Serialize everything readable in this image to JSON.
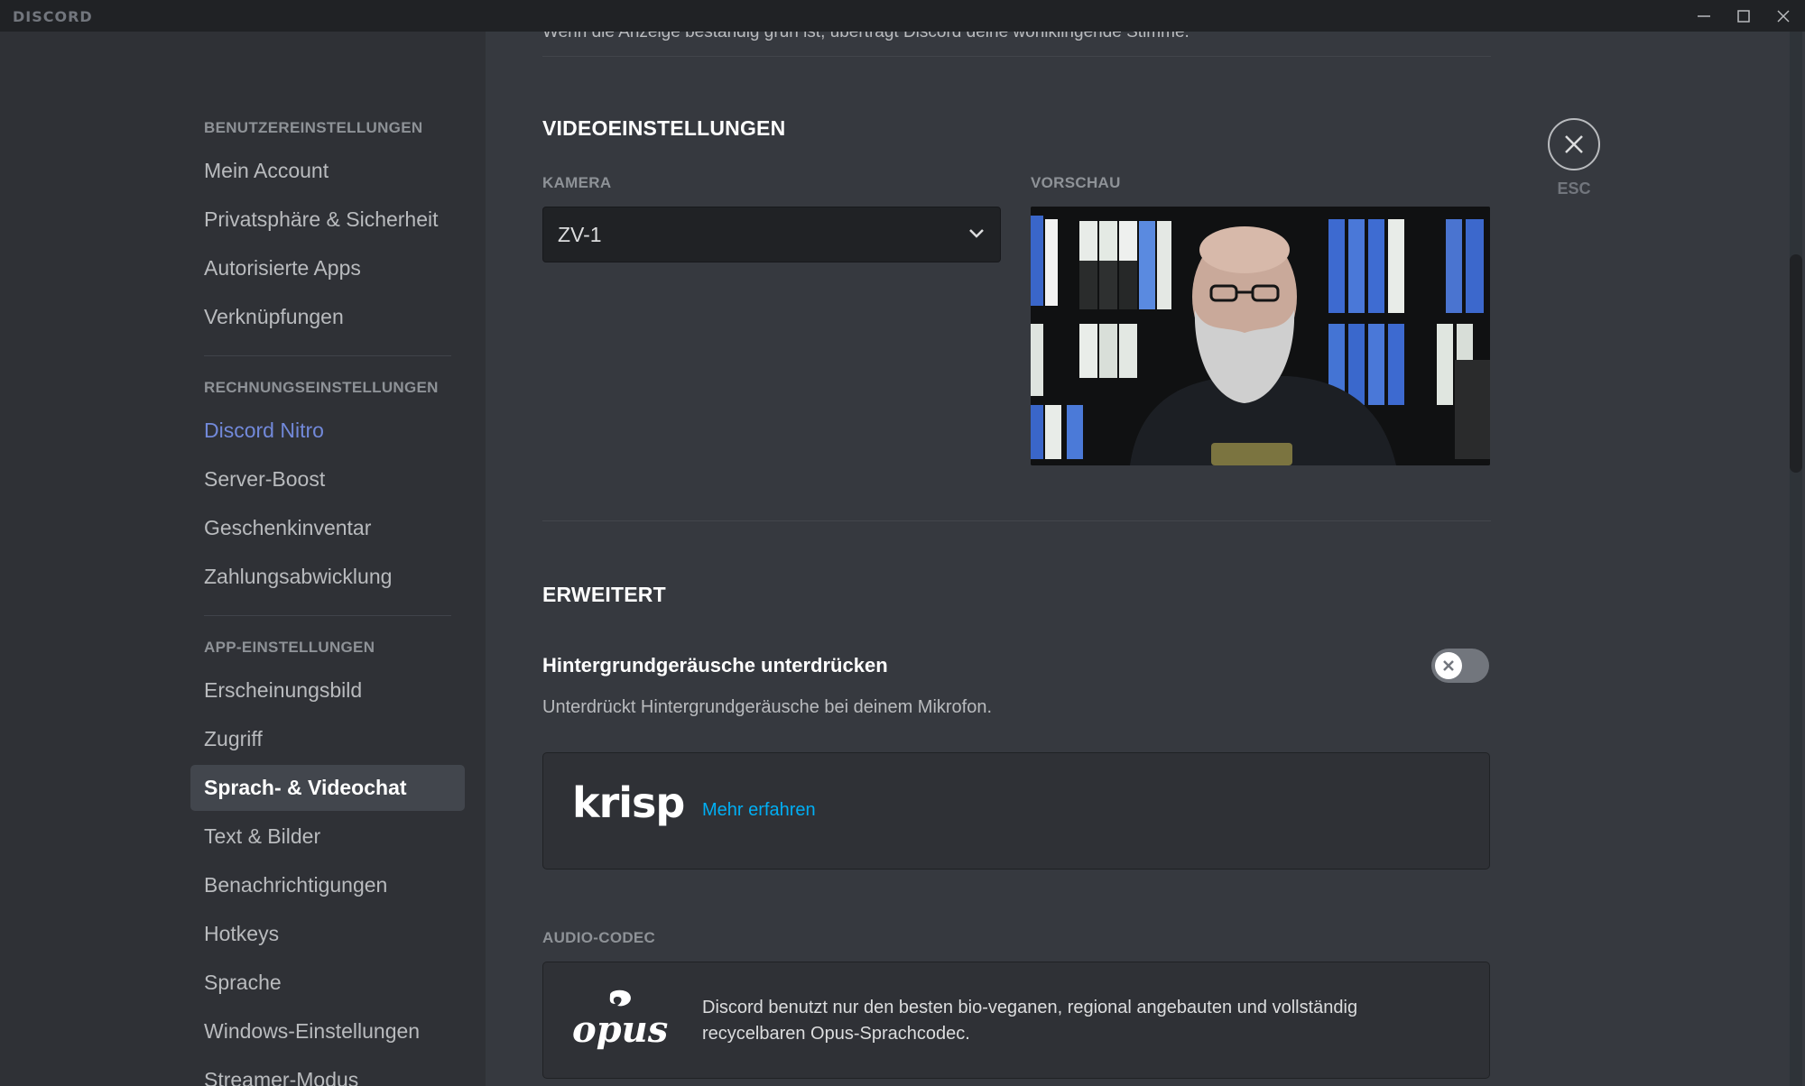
{
  "window": {
    "app_name": "DISCORD",
    "minimize_icon": "minimize-icon",
    "maximize_icon": "maximize-icon",
    "close_icon": "close-icon"
  },
  "sidebar": {
    "user_settings": {
      "header": "BENUTZEREINSTELLUNGEN",
      "items": [
        "Mein Account",
        "Privatsphäre & Sicherheit",
        "Autorisierte Apps",
        "Verknüpfungen"
      ]
    },
    "billing_settings": {
      "header": "RECHNUNGSEINSTELLUNGEN",
      "items": [
        "Discord Nitro",
        "Server-Boost",
        "Geschenkinventar",
        "Zahlungsabwicklung"
      ]
    },
    "app_settings": {
      "header": "APP-EINSTELLUNGEN",
      "items": [
        "Erscheinungsbild",
        "Zugriff",
        "Sprach- & Videochat",
        "Text & Bilder",
        "Benachrichtigungen",
        "Hotkeys",
        "Sprache",
        "Windows-Einstellungen",
        "Streamer-Modus"
      ]
    },
    "active_item": "Sprach- & Videochat",
    "nitro_color": "#7289da"
  },
  "main": {
    "cut_text": "Wenn die Anzeige beständig grün ist, überträgt Discord deine wohlklingende Stimme.",
    "video": {
      "title": "VIDEOEINSTELLUNGEN",
      "camera_label": "KAMERA",
      "camera_value": "ZV-1",
      "preview_label": "VORSCHAU"
    },
    "advanced": {
      "title": "ERWEITERT",
      "noise_title": "Hintergrundgeräusche unterdrücken",
      "noise_desc": "Unterdrückt Hintergrundgeräusche bei deinem Mikrofon.",
      "noise_enabled": false,
      "krisp_logo": "krisp",
      "krisp_link": "Mehr erfahren"
    },
    "codec": {
      "label": "AUDIO-CODEC",
      "logo": "opus",
      "text": "Discord benutzt nur den besten bio-veganen, regional angebauten und vollständig recycelbaren Opus-Sprachcodec."
    },
    "close": {
      "icon": "close-icon",
      "label": "ESC"
    }
  },
  "colors": {
    "background": "#36393f",
    "sidebar": "#2f3136",
    "titlebar": "#202225",
    "link": "#00aff4"
  }
}
